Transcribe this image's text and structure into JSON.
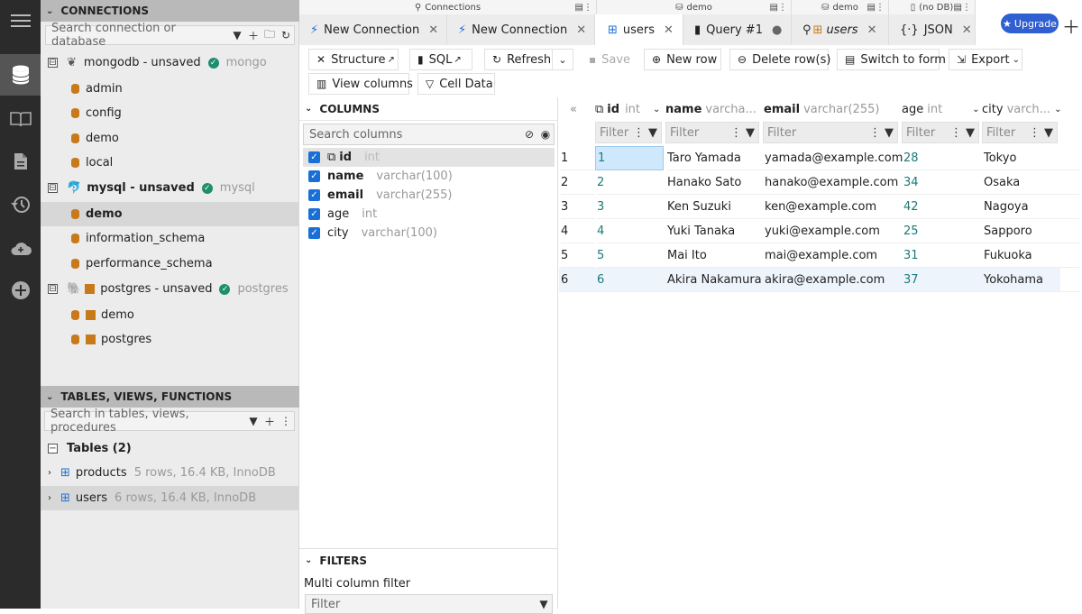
{
  "colors": {
    "accent": "#1a6fd6",
    "number_teal": "#1a7a7a",
    "ok_green": "#1e8e6e",
    "db_orange": "#c87a1a"
  },
  "activity_bar": {
    "items": [
      "menu-icon",
      "database-icon",
      "book-icon",
      "file-icon",
      "history-icon",
      "cloud-icon",
      "add-icon"
    ]
  },
  "connections": {
    "title": "CONNECTIONS",
    "search_placeholder": "Search connection or database",
    "tree": [
      {
        "label": "mongodb - unsaved",
        "type": "mongo",
        "toggle": "⊟"
      },
      {
        "label": "admin"
      },
      {
        "label": "config"
      },
      {
        "label": "demo"
      },
      {
        "label": "local"
      },
      {
        "label": "mysql - unsaved",
        "type": "mysql",
        "toggle": "⊟"
      },
      {
        "label": "demo"
      },
      {
        "label": "information_schema"
      },
      {
        "label": "performance_schema"
      },
      {
        "label": "postgres - unsaved",
        "type": "postgres",
        "toggle": "⊟"
      },
      {
        "label": "demo"
      },
      {
        "label": "postgres"
      }
    ]
  },
  "tables_section": {
    "title": "TABLES, VIEWS, FUNCTIONS",
    "search_placeholder": "Search in tables, views, procedures",
    "group_label": "Tables (2)",
    "tables": [
      {
        "name": "products",
        "info": "5 rows, 16.4 KB, InnoDB"
      },
      {
        "name": "users",
        "info": "6 rows, 16.4 KB, InnoDB"
      }
    ]
  },
  "tab_groups": [
    "Connections",
    "demo",
    "demo",
    "(no DB)"
  ],
  "tabs": [
    {
      "label": "New Connection"
    },
    {
      "label": "New Connection"
    },
    {
      "label": "users"
    },
    {
      "label": "Query #1"
    },
    {
      "label": "users"
    },
    {
      "label": "JSON"
    }
  ],
  "upgrade_label": "Upgrade",
  "toolbar": {
    "structure": "Structure",
    "sql": "SQL",
    "refresh": "Refresh",
    "save": "Save",
    "new_row": "New row",
    "delete_rows": "Delete row(s)",
    "switch_form": "Switch to form",
    "export": "Export",
    "view_columns": "View columns",
    "cell_data": "Cell Data"
  },
  "columns_panel": {
    "title": "COLUMNS",
    "search_placeholder": "Search columns",
    "columns": [
      {
        "name": "id",
        "type": "int"
      },
      {
        "name": "name",
        "type": "varchar(100)"
      },
      {
        "name": "email",
        "type": "varchar(255)"
      },
      {
        "name": "age",
        "type": "int"
      },
      {
        "name": "city",
        "type": "varchar(100)"
      }
    ]
  },
  "filters_panel": {
    "title": "FILTERS",
    "multi_label": "Multi column filter",
    "placeholder": "Filter"
  },
  "grid": {
    "collapse_glyph": "«",
    "headers": [
      {
        "name": "id",
        "type": "int"
      },
      {
        "name": "name",
        "type": "varcha..."
      },
      {
        "name": "email",
        "type": "varchar(255)"
      },
      {
        "name": "age",
        "type": "int"
      },
      {
        "name": "city",
        "type": "varch..."
      }
    ],
    "filter_placeholder": "Filter",
    "rows": [
      [
        "1",
        "1",
        "Taro Yamada",
        "yamada@example.com",
        "28",
        "Tokyo"
      ],
      [
        "2",
        "2",
        "Hanako Sato",
        "hanako@example.com",
        "34",
        "Osaka"
      ],
      [
        "3",
        "3",
        "Ken Suzuki",
        "ken@example.com",
        "42",
        "Nagoya"
      ],
      [
        "4",
        "4",
        "Yuki Tanaka",
        "yuki@example.com",
        "25",
        "Sapporo"
      ],
      [
        "5",
        "5",
        "Mai Ito",
        "mai@example.com",
        "31",
        "Fukuoka"
      ],
      [
        "6",
        "6",
        "Akira Nakamura",
        "akira@example.com",
        "37",
        "Yokohama"
      ]
    ]
  }
}
